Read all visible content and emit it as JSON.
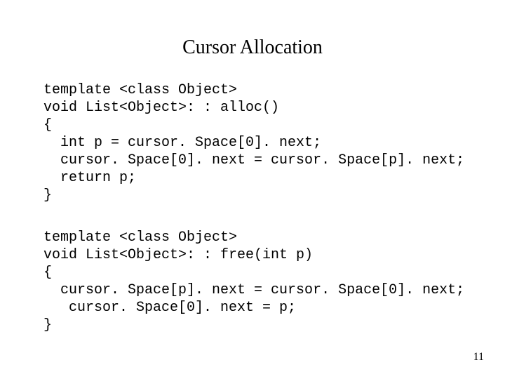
{
  "title": "Cursor Allocation",
  "code_block_1": "template <class Object>\nvoid List<Object>: : alloc()\n{\n  int p = cursor. Space[0]. next;\n  cursor. Space[0]. next = cursor. Space[p]. next;\n  return p;\n}",
  "code_block_2": "template <class Object>\nvoid List<Object>: : free(int p)\n{\n  cursor. Space[p]. next = cursor. Space[0]. next;\n   cursor. Space[0]. next = p;\n}",
  "page_number": "11"
}
